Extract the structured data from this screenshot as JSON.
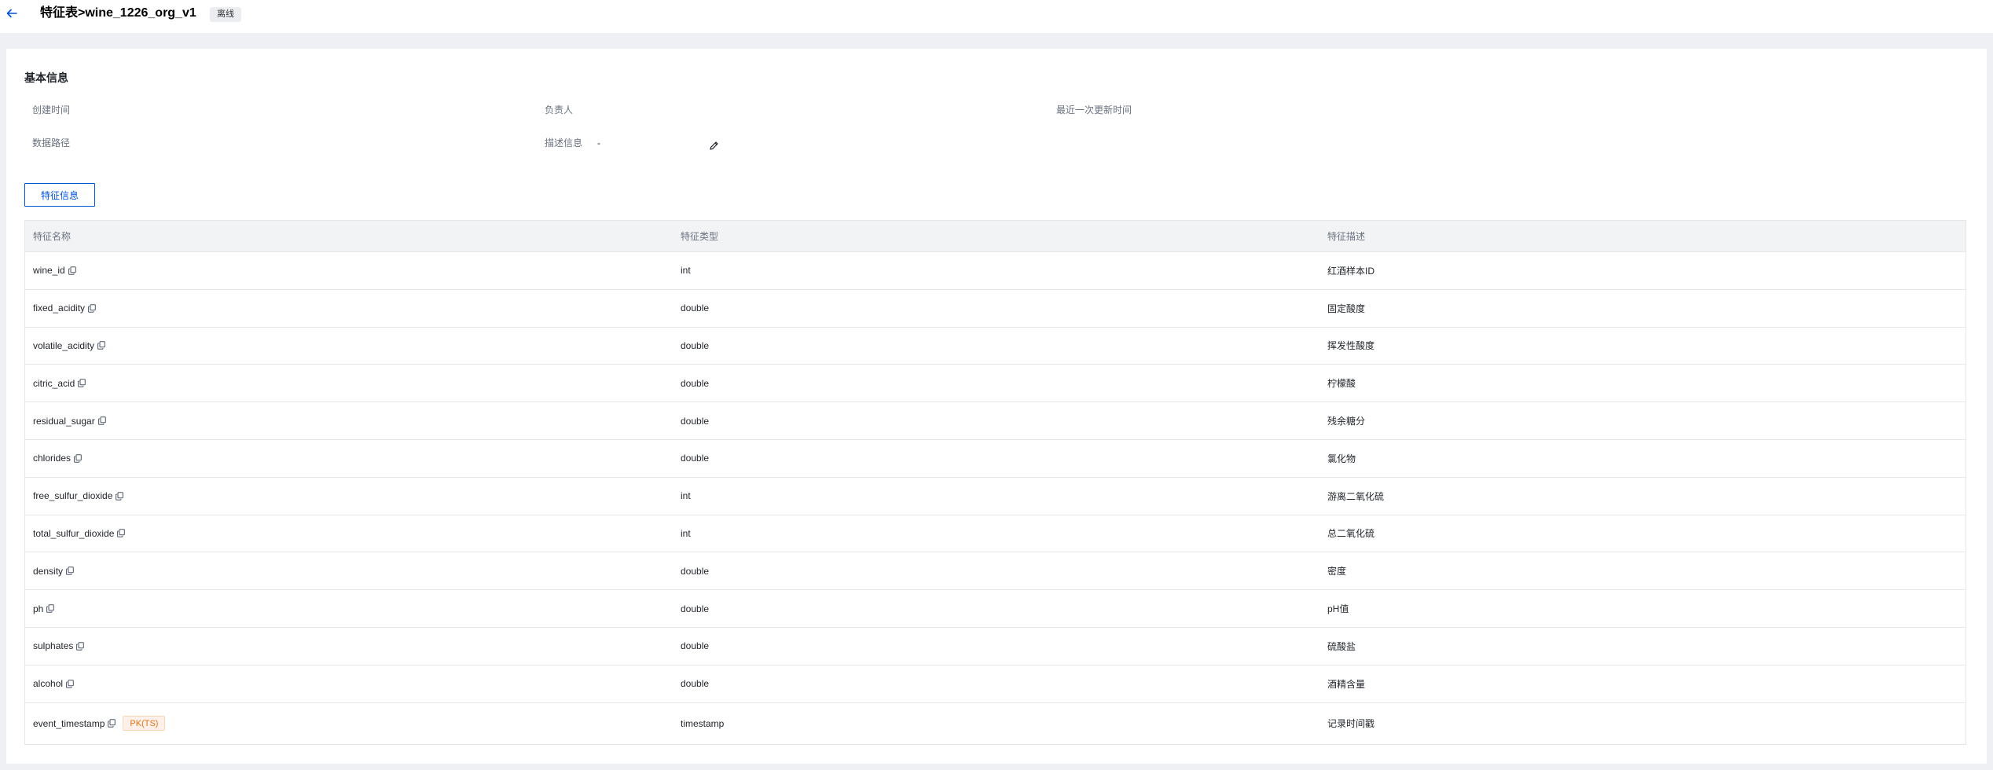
{
  "header": {
    "title": "特征表>wine_1226_org_v1",
    "status": "离线"
  },
  "basic_info": {
    "section_title": "基本信息",
    "created_label": "创建时间",
    "owner_label": "负责人",
    "updated_label": "最近一次更新时间",
    "path_label": "数据路径",
    "desc_label": "描述信息",
    "desc_value": "-"
  },
  "tab": {
    "label": "特征信息"
  },
  "table": {
    "columns": [
      "特征名称",
      "特征类型",
      "特征描述"
    ],
    "rows": [
      {
        "name": "wine_id",
        "type": "int",
        "desc": "红酒样本ID",
        "tag": ""
      },
      {
        "name": "fixed_acidity",
        "type": "double",
        "desc": "固定酸度",
        "tag": ""
      },
      {
        "name": "volatile_acidity",
        "type": "double",
        "desc": "挥发性酸度",
        "tag": ""
      },
      {
        "name": "citric_acid",
        "type": "double",
        "desc": "柠檬酸",
        "tag": ""
      },
      {
        "name": "residual_sugar",
        "type": "double",
        "desc": "残余糖分",
        "tag": ""
      },
      {
        "name": "chlorides",
        "type": "double",
        "desc": "氯化物",
        "tag": ""
      },
      {
        "name": "free_sulfur_dioxide",
        "type": "int",
        "desc": "游离二氧化硫",
        "tag": ""
      },
      {
        "name": "total_sulfur_dioxide",
        "type": "int",
        "desc": "总二氧化硫",
        "tag": ""
      },
      {
        "name": "density",
        "type": "double",
        "desc": "密度",
        "tag": ""
      },
      {
        "name": "ph",
        "type": "double",
        "desc": "pH值",
        "tag": ""
      },
      {
        "name": "sulphates",
        "type": "double",
        "desc": "硫酸盐",
        "tag": ""
      },
      {
        "name": "alcohol",
        "type": "double",
        "desc": "酒精含量",
        "tag": ""
      },
      {
        "name": "event_timestamp",
        "type": "timestamp",
        "desc": "记录时间戳",
        "tag": "PK(TS)"
      }
    ]
  },
  "colors": {
    "accent": "#0052d9",
    "pk_tag": "#e37318"
  },
  "icons": {
    "back": "arrow-left-icon",
    "edit": "pencil-icon",
    "copy": "copy-icon"
  }
}
